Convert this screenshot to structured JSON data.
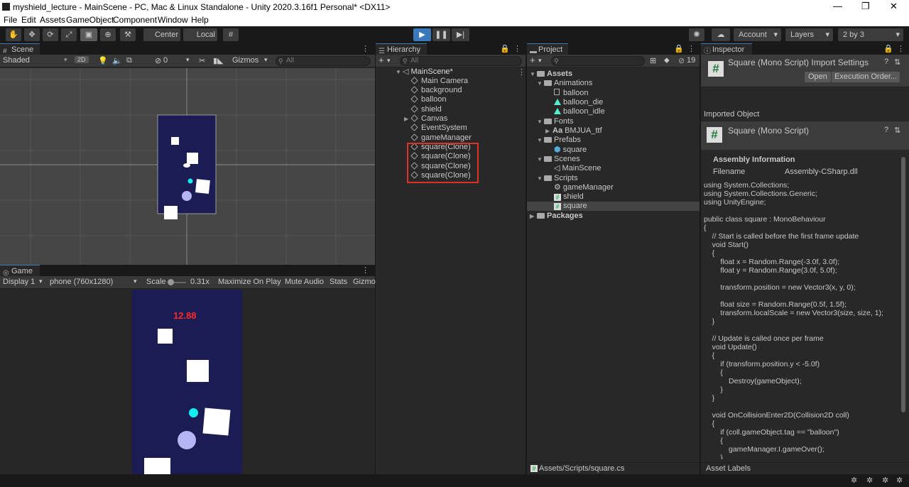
{
  "window": {
    "title": "myshield_lecture - MainScene - PC, Mac & Linux Standalone - Unity 2020.3.16f1 Personal* <DX11>",
    "minimize": "—",
    "maximize": "❐",
    "close": "✕"
  },
  "menu": [
    "File",
    "Edit",
    "Assets",
    "GameObject",
    "Component",
    "Window",
    "Help"
  ],
  "toolbar": {
    "pivot_center": "Center",
    "pivot_local": "Local",
    "account": "Account",
    "layers": "Layers",
    "layout": "2 by 3"
  },
  "scene": {
    "tab": "Scene",
    "shading": "Shaded",
    "mode_2d": "2D",
    "fx_count": "0",
    "gizmos": "Gizmos",
    "search_placeholder": "All"
  },
  "game": {
    "tab": "Game",
    "display": "Display 1",
    "resolution": "phone (760x1280)",
    "scale_label": "Scale",
    "scale_value": "0.31x",
    "maximize_on_play": "Maximize On Play",
    "mute_audio": "Mute Audio",
    "stats": "Stats",
    "gizmos": "Gizmo",
    "score": "12.88",
    "score_color": "#ff2a2a",
    "bg_color": "#1c1c55"
  },
  "hierarchy": {
    "tab": "Hierarchy",
    "search_placeholder": "All",
    "scene_name": "MainScene*",
    "items": [
      "Main Camera",
      "background",
      "balloon",
      "shield",
      "Canvas",
      "EventSystem",
      "gameManager",
      "square(Clone)",
      "square(Clone)",
      "square(Clone)",
      "square(Clone)"
    ],
    "highlight_color": "#e0302a"
  },
  "project": {
    "tab": "Project",
    "hidden_count": "19",
    "tree": [
      "Assets",
      "Animations",
      "balloon",
      "balloon_die",
      "balloon_idle",
      "Fonts",
      "BMJUA_ttf",
      "Prefabs",
      "square",
      "Scenes",
      "MainScene",
      "Scripts",
      "gameManager",
      "shield",
      "square",
      "Packages"
    ],
    "path": "Assets/Scripts/square.cs"
  },
  "inspector": {
    "tab": "Inspector",
    "header_title": "Square (Mono Script) Import Settings",
    "open_button": "Open",
    "execution_order_button": "Execution Order...",
    "imported_object": "Imported Object",
    "object_title": "Square (Mono Script)",
    "assembly_info": "Assembly Information",
    "filename_label": "Filename",
    "filename_value": "Assembly-CSharp.dll",
    "asset_labels": "Asset Labels",
    "code": "using System.Collections;\nusing System.Collections.Generic;\nusing UnityEngine;\n\npublic class square : MonoBehaviour\n{\n    // Start is called before the first frame update\n    void Start()\n    {\n        float x = Random.Range(-3.0f, 3.0f);\n        float y = Random.Range(3.0f, 5.0f);\n\n        transform.position = new Vector3(x, y, 0);\n\n        float size = Random.Range(0.5f, 1.5f);\n        transform.localScale = new Vector3(size, size, 1);\n    }\n\n    // Update is called once per frame\n    void Update()\n    {\n        if (transform.position.y < -5.0f)\n        {\n            Destroy(gameObject);\n        }\n    }\n\n    void OnCollisionEnter2D(Collision2D coll)\n    {\n        if (coll.gameObject.tag == \"balloon\")\n        {\n            gameManager.I.gameOver();\n        }"
  }
}
